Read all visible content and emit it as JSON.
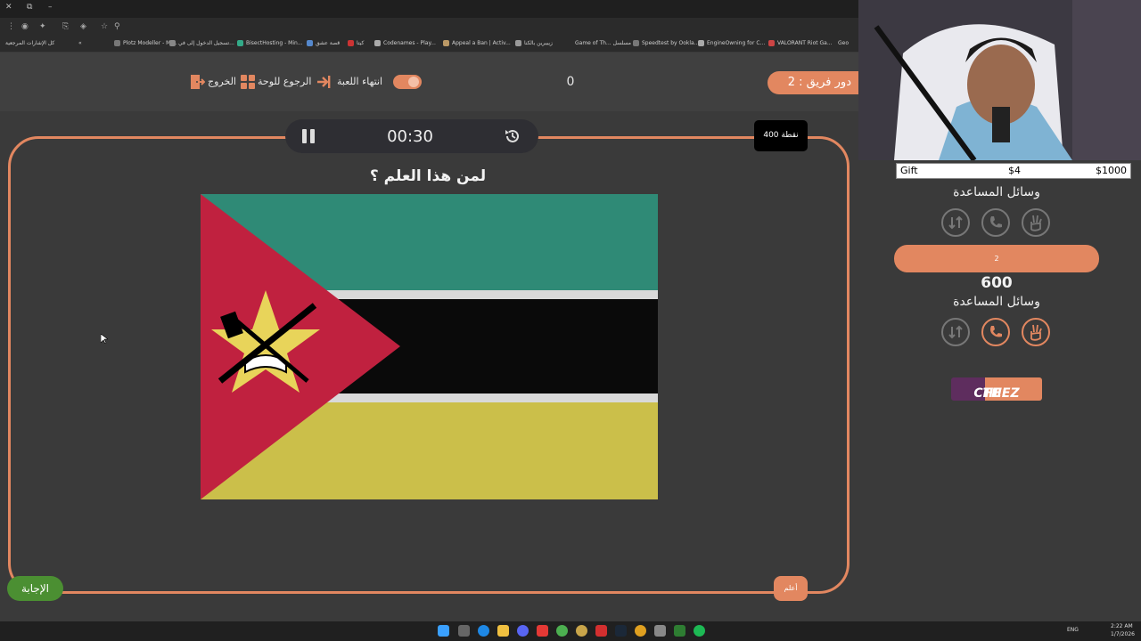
{
  "browser": {
    "bookmarks": [
      "كل الإشارات المرجعية",
      "Plotz Modeller - Mi...",
      "تسجيل الدخول إلى في...",
      "BisectHosting - Min...",
      "قصة عشق",
      "كيتا",
      "Codenames - Play...",
      "Appeal a Ban | Activ...",
      "زيبيرين بالكنا",
      "Game of Th... مسلسل",
      "Speedtest by Ookla...",
      "EngineOwning for C...",
      "VALORANT Riot Ga...",
      "Geo"
    ]
  },
  "header": {
    "team_turn": "دور فريق : 2",
    "score": "0",
    "end_game": "انتهاء اللعبة",
    "back_to_board": "الرجوع للوحة",
    "exit": "الخروج"
  },
  "question": {
    "timer": "00:30",
    "points": "400 نقطة",
    "text": "لمن هذا العلم ؟",
    "answer_label": "الإجابة",
    "small_button": "أعلم"
  },
  "side": {
    "gift_label": "Gift",
    "gift_price": "$4",
    "gift_goal": "$1000",
    "help_title_1": "وسائل المساعدة",
    "team_bar": "2",
    "team_score": "600",
    "help_title_2": "وسائل المساعدة",
    "sponsor_1": "THE",
    "sponsor_2": "CHEFZ"
  },
  "taskbar": {
    "lang": "ENG",
    "time": "2:22 AM",
    "date": "1/7/2026"
  },
  "colors": {
    "accent": "#e28760",
    "answer_green": "#4b8f32",
    "flag_green": "#2f8a76",
    "flag_red": "#c0213f",
    "flag_yellow": "#cbbf4a",
    "flag_black": "#0a0a0a"
  }
}
